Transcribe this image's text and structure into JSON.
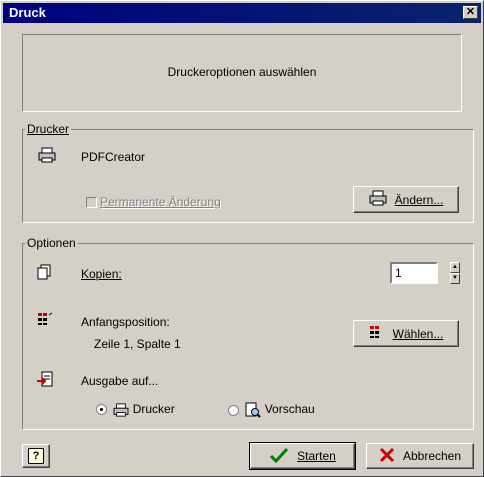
{
  "window": {
    "title": "Druck",
    "close_glyph": "✕"
  },
  "banner": {
    "text": "Druckeroptionen auswählen"
  },
  "printer_group": {
    "legend": "Drucker",
    "printer_name": "PDFCreator",
    "permanent_change_label": "Permanente Änderung",
    "permanent_change_checked": false,
    "change_button_label": "Ändern..."
  },
  "options_group": {
    "legend": "Optionen",
    "copies_label": "Kopien:",
    "copies_value": "1",
    "start_position_label": "Anfangsposition:",
    "start_position_value": "Zeile 1, Spalte 1",
    "choose_button_label": "Wählen...",
    "output_label": "Ausgabe auf...",
    "radio_printer_label": "Drucker",
    "radio_printer_selected": true,
    "radio_preview_label": "Vorschau",
    "radio_preview_selected": false
  },
  "footer": {
    "help_glyph": "?",
    "start_button_label": "Starten",
    "cancel_button_label": "Abbrechen"
  },
  "icons": {
    "printer": "printer-icon",
    "copies": "copies-icon",
    "start_position": "grid-position-icon",
    "output": "output-icon",
    "preview": "preview-magnifier-icon",
    "check": "checkmark-icon",
    "cross": "red-x-icon"
  },
  "colors": {
    "titlebar": "#000080",
    "face": "#d4d0c8",
    "cancel_x": "#cc0000",
    "check": "#008000"
  }
}
